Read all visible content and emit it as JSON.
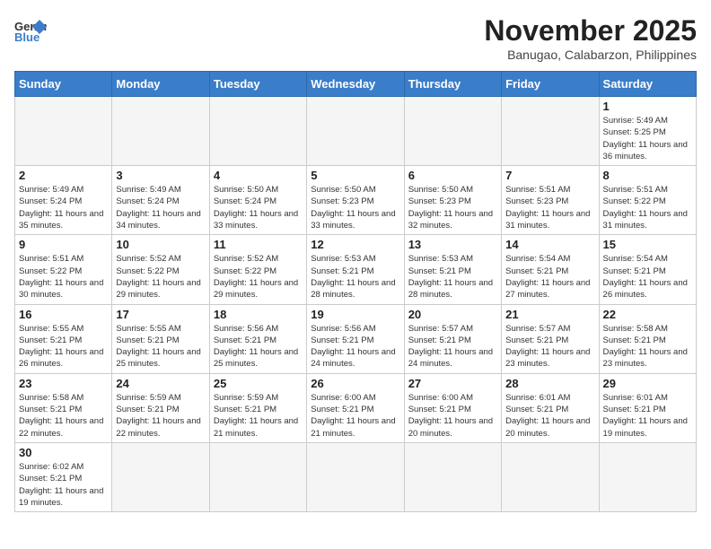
{
  "header": {
    "logo_general": "General",
    "logo_blue": "Blue",
    "month_title": "November 2025",
    "location": "Banugao, Calabarzon, Philippines"
  },
  "days_of_week": [
    "Sunday",
    "Monday",
    "Tuesday",
    "Wednesday",
    "Thursday",
    "Friday",
    "Saturday"
  ],
  "weeks": [
    [
      {
        "day": "",
        "info": ""
      },
      {
        "day": "",
        "info": ""
      },
      {
        "day": "",
        "info": ""
      },
      {
        "day": "",
        "info": ""
      },
      {
        "day": "",
        "info": ""
      },
      {
        "day": "",
        "info": ""
      },
      {
        "day": "1",
        "info": "Sunrise: 5:49 AM\nSunset: 5:25 PM\nDaylight: 11 hours and 36 minutes."
      }
    ],
    [
      {
        "day": "2",
        "info": "Sunrise: 5:49 AM\nSunset: 5:24 PM\nDaylight: 11 hours and 35 minutes."
      },
      {
        "day": "3",
        "info": "Sunrise: 5:49 AM\nSunset: 5:24 PM\nDaylight: 11 hours and 34 minutes."
      },
      {
        "day": "4",
        "info": "Sunrise: 5:50 AM\nSunset: 5:24 PM\nDaylight: 11 hours and 33 minutes."
      },
      {
        "day": "5",
        "info": "Sunrise: 5:50 AM\nSunset: 5:23 PM\nDaylight: 11 hours and 33 minutes."
      },
      {
        "day": "6",
        "info": "Sunrise: 5:50 AM\nSunset: 5:23 PM\nDaylight: 11 hours and 32 minutes."
      },
      {
        "day": "7",
        "info": "Sunrise: 5:51 AM\nSunset: 5:23 PM\nDaylight: 11 hours and 31 minutes."
      },
      {
        "day": "8",
        "info": "Sunrise: 5:51 AM\nSunset: 5:22 PM\nDaylight: 11 hours and 31 minutes."
      }
    ],
    [
      {
        "day": "9",
        "info": "Sunrise: 5:51 AM\nSunset: 5:22 PM\nDaylight: 11 hours and 30 minutes."
      },
      {
        "day": "10",
        "info": "Sunrise: 5:52 AM\nSunset: 5:22 PM\nDaylight: 11 hours and 29 minutes."
      },
      {
        "day": "11",
        "info": "Sunrise: 5:52 AM\nSunset: 5:22 PM\nDaylight: 11 hours and 29 minutes."
      },
      {
        "day": "12",
        "info": "Sunrise: 5:53 AM\nSunset: 5:21 PM\nDaylight: 11 hours and 28 minutes."
      },
      {
        "day": "13",
        "info": "Sunrise: 5:53 AM\nSunset: 5:21 PM\nDaylight: 11 hours and 28 minutes."
      },
      {
        "day": "14",
        "info": "Sunrise: 5:54 AM\nSunset: 5:21 PM\nDaylight: 11 hours and 27 minutes."
      },
      {
        "day": "15",
        "info": "Sunrise: 5:54 AM\nSunset: 5:21 PM\nDaylight: 11 hours and 26 minutes."
      }
    ],
    [
      {
        "day": "16",
        "info": "Sunrise: 5:55 AM\nSunset: 5:21 PM\nDaylight: 11 hours and 26 minutes."
      },
      {
        "day": "17",
        "info": "Sunrise: 5:55 AM\nSunset: 5:21 PM\nDaylight: 11 hours and 25 minutes."
      },
      {
        "day": "18",
        "info": "Sunrise: 5:56 AM\nSunset: 5:21 PM\nDaylight: 11 hours and 25 minutes."
      },
      {
        "day": "19",
        "info": "Sunrise: 5:56 AM\nSunset: 5:21 PM\nDaylight: 11 hours and 24 minutes."
      },
      {
        "day": "20",
        "info": "Sunrise: 5:57 AM\nSunset: 5:21 PM\nDaylight: 11 hours and 24 minutes."
      },
      {
        "day": "21",
        "info": "Sunrise: 5:57 AM\nSunset: 5:21 PM\nDaylight: 11 hours and 23 minutes."
      },
      {
        "day": "22",
        "info": "Sunrise: 5:58 AM\nSunset: 5:21 PM\nDaylight: 11 hours and 23 minutes."
      }
    ],
    [
      {
        "day": "23",
        "info": "Sunrise: 5:58 AM\nSunset: 5:21 PM\nDaylight: 11 hours and 22 minutes."
      },
      {
        "day": "24",
        "info": "Sunrise: 5:59 AM\nSunset: 5:21 PM\nDaylight: 11 hours and 22 minutes."
      },
      {
        "day": "25",
        "info": "Sunrise: 5:59 AM\nSunset: 5:21 PM\nDaylight: 11 hours and 21 minutes."
      },
      {
        "day": "26",
        "info": "Sunrise: 6:00 AM\nSunset: 5:21 PM\nDaylight: 11 hours and 21 minutes."
      },
      {
        "day": "27",
        "info": "Sunrise: 6:00 AM\nSunset: 5:21 PM\nDaylight: 11 hours and 20 minutes."
      },
      {
        "day": "28",
        "info": "Sunrise: 6:01 AM\nSunset: 5:21 PM\nDaylight: 11 hours and 20 minutes."
      },
      {
        "day": "29",
        "info": "Sunrise: 6:01 AM\nSunset: 5:21 PM\nDaylight: 11 hours and 19 minutes."
      }
    ],
    [
      {
        "day": "30",
        "info": "Sunrise: 6:02 AM\nSunset: 5:21 PM\nDaylight: 11 hours and 19 minutes."
      },
      {
        "day": "",
        "info": ""
      },
      {
        "day": "",
        "info": ""
      },
      {
        "day": "",
        "info": ""
      },
      {
        "day": "",
        "info": ""
      },
      {
        "day": "",
        "info": ""
      },
      {
        "day": "",
        "info": ""
      }
    ]
  ]
}
